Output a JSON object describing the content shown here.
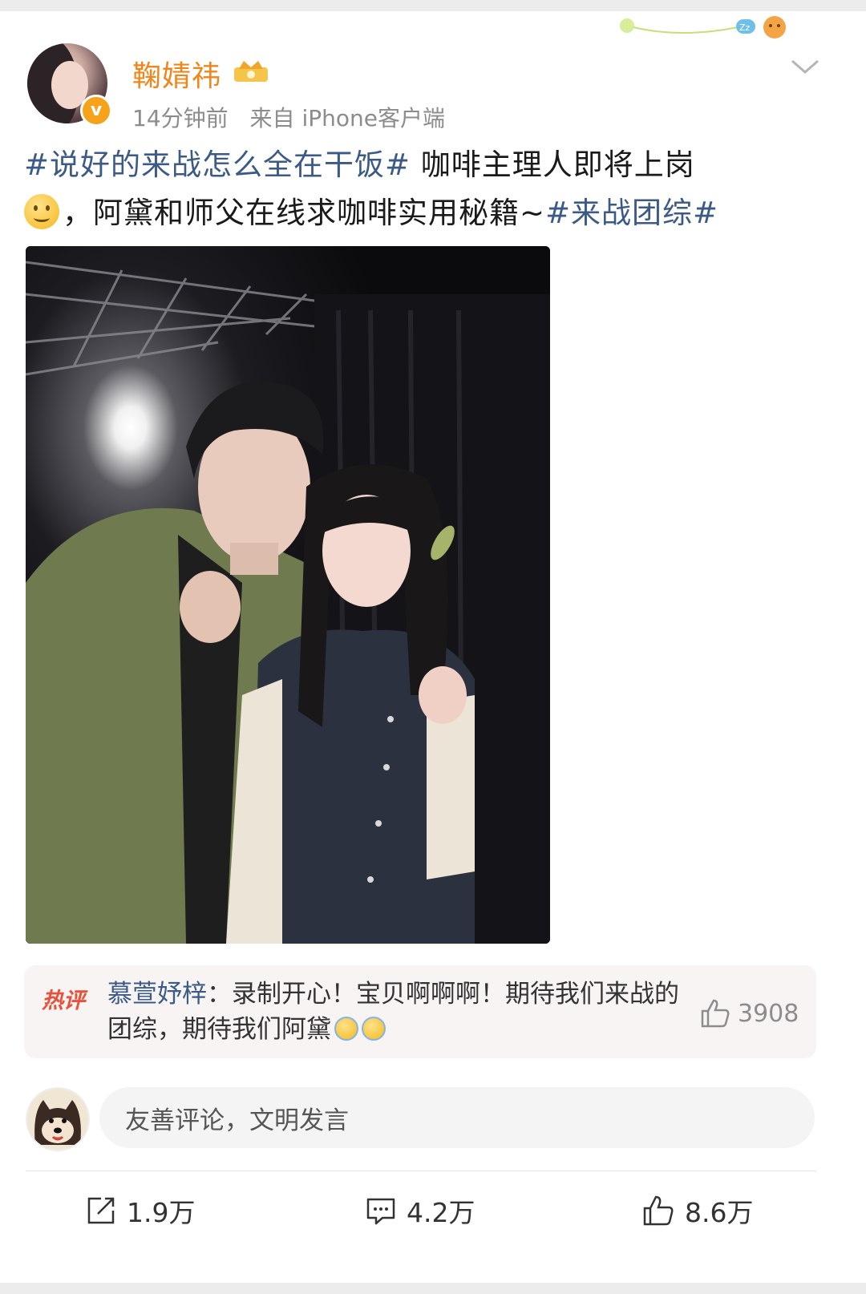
{
  "post": {
    "author": "鞠婧祎",
    "time": "14分钟前",
    "source": "来自 iPhone客户端",
    "text": {
      "hashtag1": "#说好的来战怎么全在干饭#",
      "part1": "咖啡主理人即将上岗",
      "part2": "，阿黛和师父在线求咖啡实用秘籍~",
      "hashtag2": "#来战团综#"
    }
  },
  "hot_comment": {
    "label": "热评",
    "user": "慕萱妤梓",
    "separator": "：",
    "text": "录制开心！宝贝啊啊啊！期待我们来战的团综，期待我们阿黛",
    "likes": "3908"
  },
  "reply": {
    "placeholder": "友善评论，文明发言"
  },
  "actions": {
    "repost": "1.9万",
    "comments": "4.2万",
    "likes": "8.6万"
  },
  "icons": {
    "verified": "verified-v-icon",
    "crown": "crown-icon",
    "chevron": "chevron-down-icon",
    "like": "thumbs-up-icon",
    "repost": "repost-icon",
    "comment": "comment-icon"
  },
  "colors": {
    "username": "#f08519",
    "hashtag": "#3b5a86",
    "hot_label": "#e8503a"
  }
}
